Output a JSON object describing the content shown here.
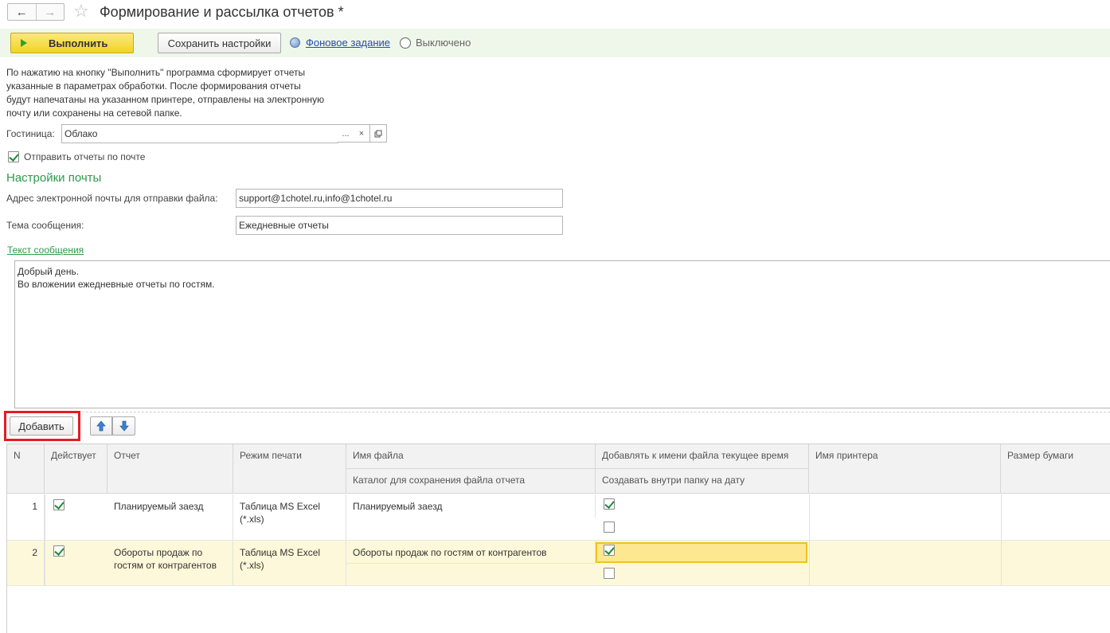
{
  "window": {
    "title": "Формирование и рассылка отчетов *",
    "back_icon": "arrow-left-icon",
    "forward_icon": "arrow-right-icon",
    "favorite_icon": "star-icon"
  },
  "toolbar": {
    "run_label": "Выполнить",
    "save_settings_label": "Сохранить настройки",
    "background_job_link": "Фоновое задание",
    "background_job_status": "Выключено"
  },
  "description": "По нажатию на кнопку \"Выполнить\" программа сформирует отчеты указанные в параметрах обработки. После формирования отчеты будут напечатаны на указанном принтере, отправлены на электронную почту или сохранены на сетевой папке.",
  "hotel": {
    "label": "Гостиница:",
    "value": "Облако",
    "select_button": "...",
    "clear_button": "×"
  },
  "send_by_mail": {
    "label": "Отправить отчеты по почте",
    "checked": true
  },
  "mail_settings": {
    "title": "Настройки почты",
    "email_label": "Адрес электронной почты для отправки файла:",
    "email_value": "support@1chotel.ru,info@1chotel.ru",
    "subject_label": "Тема сообщения:",
    "subject_value": "Ежедневные отчеты",
    "message_link": "Текст сообщения",
    "message_line1": "Добрый день.",
    "message_line2": "Во вложении ежедневные отчеты по гостям."
  },
  "table_toolbar": {
    "add_label": "Добавить"
  },
  "table": {
    "headers": {
      "n": "N",
      "active": "Действует",
      "report": "Отчет",
      "print_mode": "Режим печати",
      "file_name": "Имя файла",
      "save_dir": "Каталог для сохранения файла отчета",
      "add_time": "Добавлять к имени файла текущее время",
      "create_folder": "Создавать внутри папку на дату",
      "printer": "Имя принтера",
      "paper_size": "Размер бумаги"
    },
    "rows": [
      {
        "n": "1",
        "active": true,
        "report": "Планируемый заезд",
        "print_mode": "Таблица MS Excel (*.xls)",
        "file_name": "Планируемый заезд",
        "add_time": true,
        "create_folder": false
      },
      {
        "n": "2",
        "active": true,
        "report": "Обороты продаж по гостям от контрагентов",
        "print_mode": "Таблица MS Excel (*.xls)",
        "file_name": "Обороты продаж по гостям от контрагентов",
        "add_time": true,
        "create_folder": false
      }
    ]
  },
  "colors": {
    "accent_green": "#2c9a49",
    "run_button": "#f2d328",
    "selected_row": "#fdf8d9",
    "highlight_box": "#e51c23"
  }
}
